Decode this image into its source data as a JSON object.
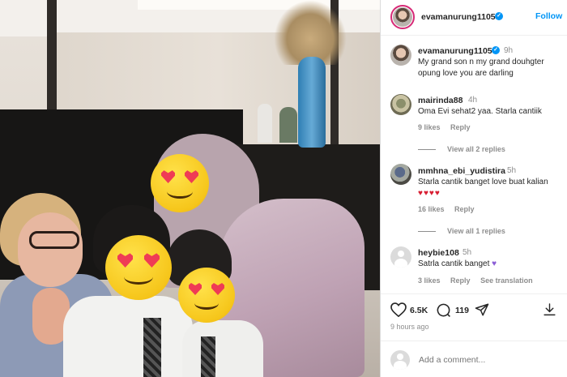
{
  "post": {
    "author": "evamanurung1105",
    "follow_label": "Follow",
    "caption_author": "evamanurung1105",
    "caption_time": "9h",
    "caption_text": "My grand son n my grand douhgter opung love you are darling"
  },
  "comments": [
    {
      "username": "mairinda88",
      "time": "4h",
      "text": "Oma Evi sehat2 yaa. Starla cantiik",
      "likes": "9 likes",
      "reply": "Reply",
      "view_replies": "View all 2 replies"
    },
    {
      "username": "mmhna_ebi_yudistira",
      "time": "5h",
      "text": "Starla cantik banget love buat kalian",
      "emoji": "♥♥♥♥",
      "likes": "16 likes",
      "reply": "Reply",
      "view_replies": "View all 1 replies"
    },
    {
      "username": "heybie108",
      "time": "5h",
      "text": "Satrla cantik banget",
      "emoji": "♥",
      "likes": "3 likes",
      "reply": "Reply",
      "translation": "See translation"
    }
  ],
  "actions": {
    "like_count": "6.5K",
    "comment_count": "119",
    "posted_ago": "9 hours ago"
  },
  "add_comment": {
    "placeholder": "Add a comment..."
  },
  "icons": {
    "like": "heart-icon",
    "comment": "comment-bubble-icon",
    "share": "paper-plane-icon",
    "save": "download-icon",
    "verified": "verified-badge-icon"
  },
  "colors": {
    "accent": "#0095f6",
    "text": "#262626",
    "muted": "#8e8e8e",
    "heart_red": "#d81e32",
    "heart_purple": "#8a5cd6"
  }
}
